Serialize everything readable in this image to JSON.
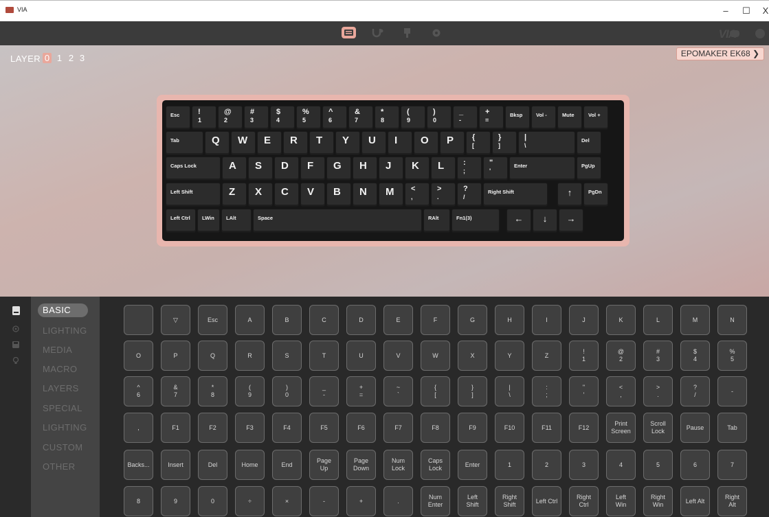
{
  "window": {
    "title": "VIA",
    "minimize": "–",
    "maximize": "☐",
    "close": "X"
  },
  "navbar": {
    "tabs": [
      {
        "name": "configure-icon",
        "active": true
      },
      {
        "name": "key-tester-icon"
      },
      {
        "name": "design-icon"
      },
      {
        "name": "settings-icon"
      }
    ],
    "brand": "VIA"
  },
  "layers": {
    "label": "LAYER",
    "items": [
      "0",
      "1",
      "2",
      "3"
    ],
    "selected": "0"
  },
  "device": {
    "name": "EPOMAKER EK68 ❯"
  },
  "keyboard": {
    "row1": [
      {
        "t": "Esc"
      },
      {
        "s": [
          "!",
          "1"
        ]
      },
      {
        "s": [
          "@",
          "2"
        ]
      },
      {
        "s": [
          "#",
          "3"
        ]
      },
      {
        "s": [
          "$",
          "4"
        ]
      },
      {
        "s": [
          "%",
          "5"
        ]
      },
      {
        "s": [
          "^",
          "6"
        ]
      },
      {
        "s": [
          "&",
          "7"
        ]
      },
      {
        "s": [
          "*",
          "8"
        ]
      },
      {
        "s": [
          "(",
          "9"
        ]
      },
      {
        "s": [
          ")",
          "0"
        ]
      },
      {
        "s": [
          "_",
          "-"
        ]
      },
      {
        "s": [
          "+",
          "="
        ]
      },
      {
        "t": "Bksp"
      },
      {
        "t": "Vol -"
      },
      {
        "t": "Mute"
      },
      {
        "t": "Vol +"
      }
    ],
    "row2": [
      {
        "t": "Tab"
      },
      {
        "b": "Q"
      },
      {
        "b": "W"
      },
      {
        "b": "E"
      },
      {
        "b": "R"
      },
      {
        "b": "T"
      },
      {
        "b": "Y"
      },
      {
        "b": "U"
      },
      {
        "b": "I"
      },
      {
        "b": "O"
      },
      {
        "b": "P"
      },
      {
        "s": [
          "{",
          "["
        ]
      },
      {
        "s": [
          "}",
          "]"
        ]
      },
      {
        "s": [
          "|",
          "\\"
        ]
      },
      {
        "t": "Del"
      }
    ],
    "row3": [
      {
        "t": "Caps Lock"
      },
      {
        "b": "A"
      },
      {
        "b": "S"
      },
      {
        "b": "D"
      },
      {
        "b": "F"
      },
      {
        "b": "G"
      },
      {
        "b": "H"
      },
      {
        "b": "J"
      },
      {
        "b": "K"
      },
      {
        "b": "L"
      },
      {
        "s": [
          ":",
          ";"
        ]
      },
      {
        "s": [
          "\"",
          "'"
        ]
      },
      {
        "t": "Enter"
      },
      {
        "t": "PgUp"
      }
    ],
    "row4": [
      {
        "t": "Left Shift"
      },
      {
        "b": "Z"
      },
      {
        "b": "X"
      },
      {
        "b": "C"
      },
      {
        "b": "V"
      },
      {
        "b": "B"
      },
      {
        "b": "N"
      },
      {
        "b": "M"
      },
      {
        "s": [
          "<",
          ","
        ]
      },
      {
        "s": [
          ">",
          "."
        ]
      },
      {
        "s": [
          "?",
          "/"
        ]
      },
      {
        "t": "Right Shift"
      },
      {
        "c": "↑"
      },
      {
        "t": "PgDn"
      }
    ],
    "row5": [
      {
        "t": "Left Ctrl"
      },
      {
        "t": "LWin"
      },
      {
        "t": "LAlt"
      },
      {
        "t": "Space"
      },
      {
        "t": "RAlt"
      },
      {
        "t": "Fn1(3)"
      },
      {
        "c": "←"
      },
      {
        "c": "↓"
      },
      {
        "c": "→"
      }
    ]
  },
  "categories": {
    "items": [
      "BASIC",
      "LIGHTING",
      "MEDIA",
      "MACRO",
      "LAYERS",
      "SPECIAL",
      "LIGHTING",
      "CUSTOM",
      "OTHER"
    ],
    "selected": "BASIC"
  },
  "keycodes": [
    [
      "",
      "▽",
      "Esc",
      "A",
      "B",
      "C",
      "D",
      "E",
      "F",
      "G",
      "H",
      "I",
      "J",
      "K",
      "L",
      "M",
      "N"
    ],
    [
      "O",
      "P",
      "Q",
      "R",
      "S",
      "T",
      "U",
      "V",
      "W",
      "X",
      "Y",
      "Z",
      "!\n1",
      "@\n2",
      "#\n3",
      "$\n4",
      "%\n5"
    ],
    [
      "^\n6",
      "&\n7",
      "*\n8",
      "(\n9",
      ")\n0",
      "_\n-",
      "+\n=",
      "~\n`",
      "{\n[",
      "}\n]",
      "|\n\\",
      ":\n;",
      "\"\n'",
      "<\n,",
      ">\n.",
      "?\n/",
      "-"
    ],
    [
      ",",
      "F1",
      "F2",
      "F3",
      "F4",
      "F5",
      "F6",
      "F7",
      "F8",
      "F9",
      "F10",
      "F11",
      "F12",
      "Print\nScreen",
      "Scroll\nLock",
      "Pause",
      "Tab"
    ],
    [
      "Backs...",
      "Insert",
      "Del",
      "Home",
      "End",
      "Page\nUp",
      "Page\nDown",
      "Num\nLock",
      "Caps\nLock",
      "Enter",
      "1",
      "2",
      "3",
      "4",
      "5",
      "6",
      "7"
    ],
    [
      "8",
      "9",
      "0",
      "÷",
      "×",
      "-",
      "+",
      ".",
      "Num\nEnter",
      "Left\nShift",
      "Right\nShift",
      "Left Ctrl",
      "Right\nCtrl",
      "Left\nWin",
      "Right\nWin",
      "Left Alt",
      "Right\nAlt"
    ]
  ]
}
